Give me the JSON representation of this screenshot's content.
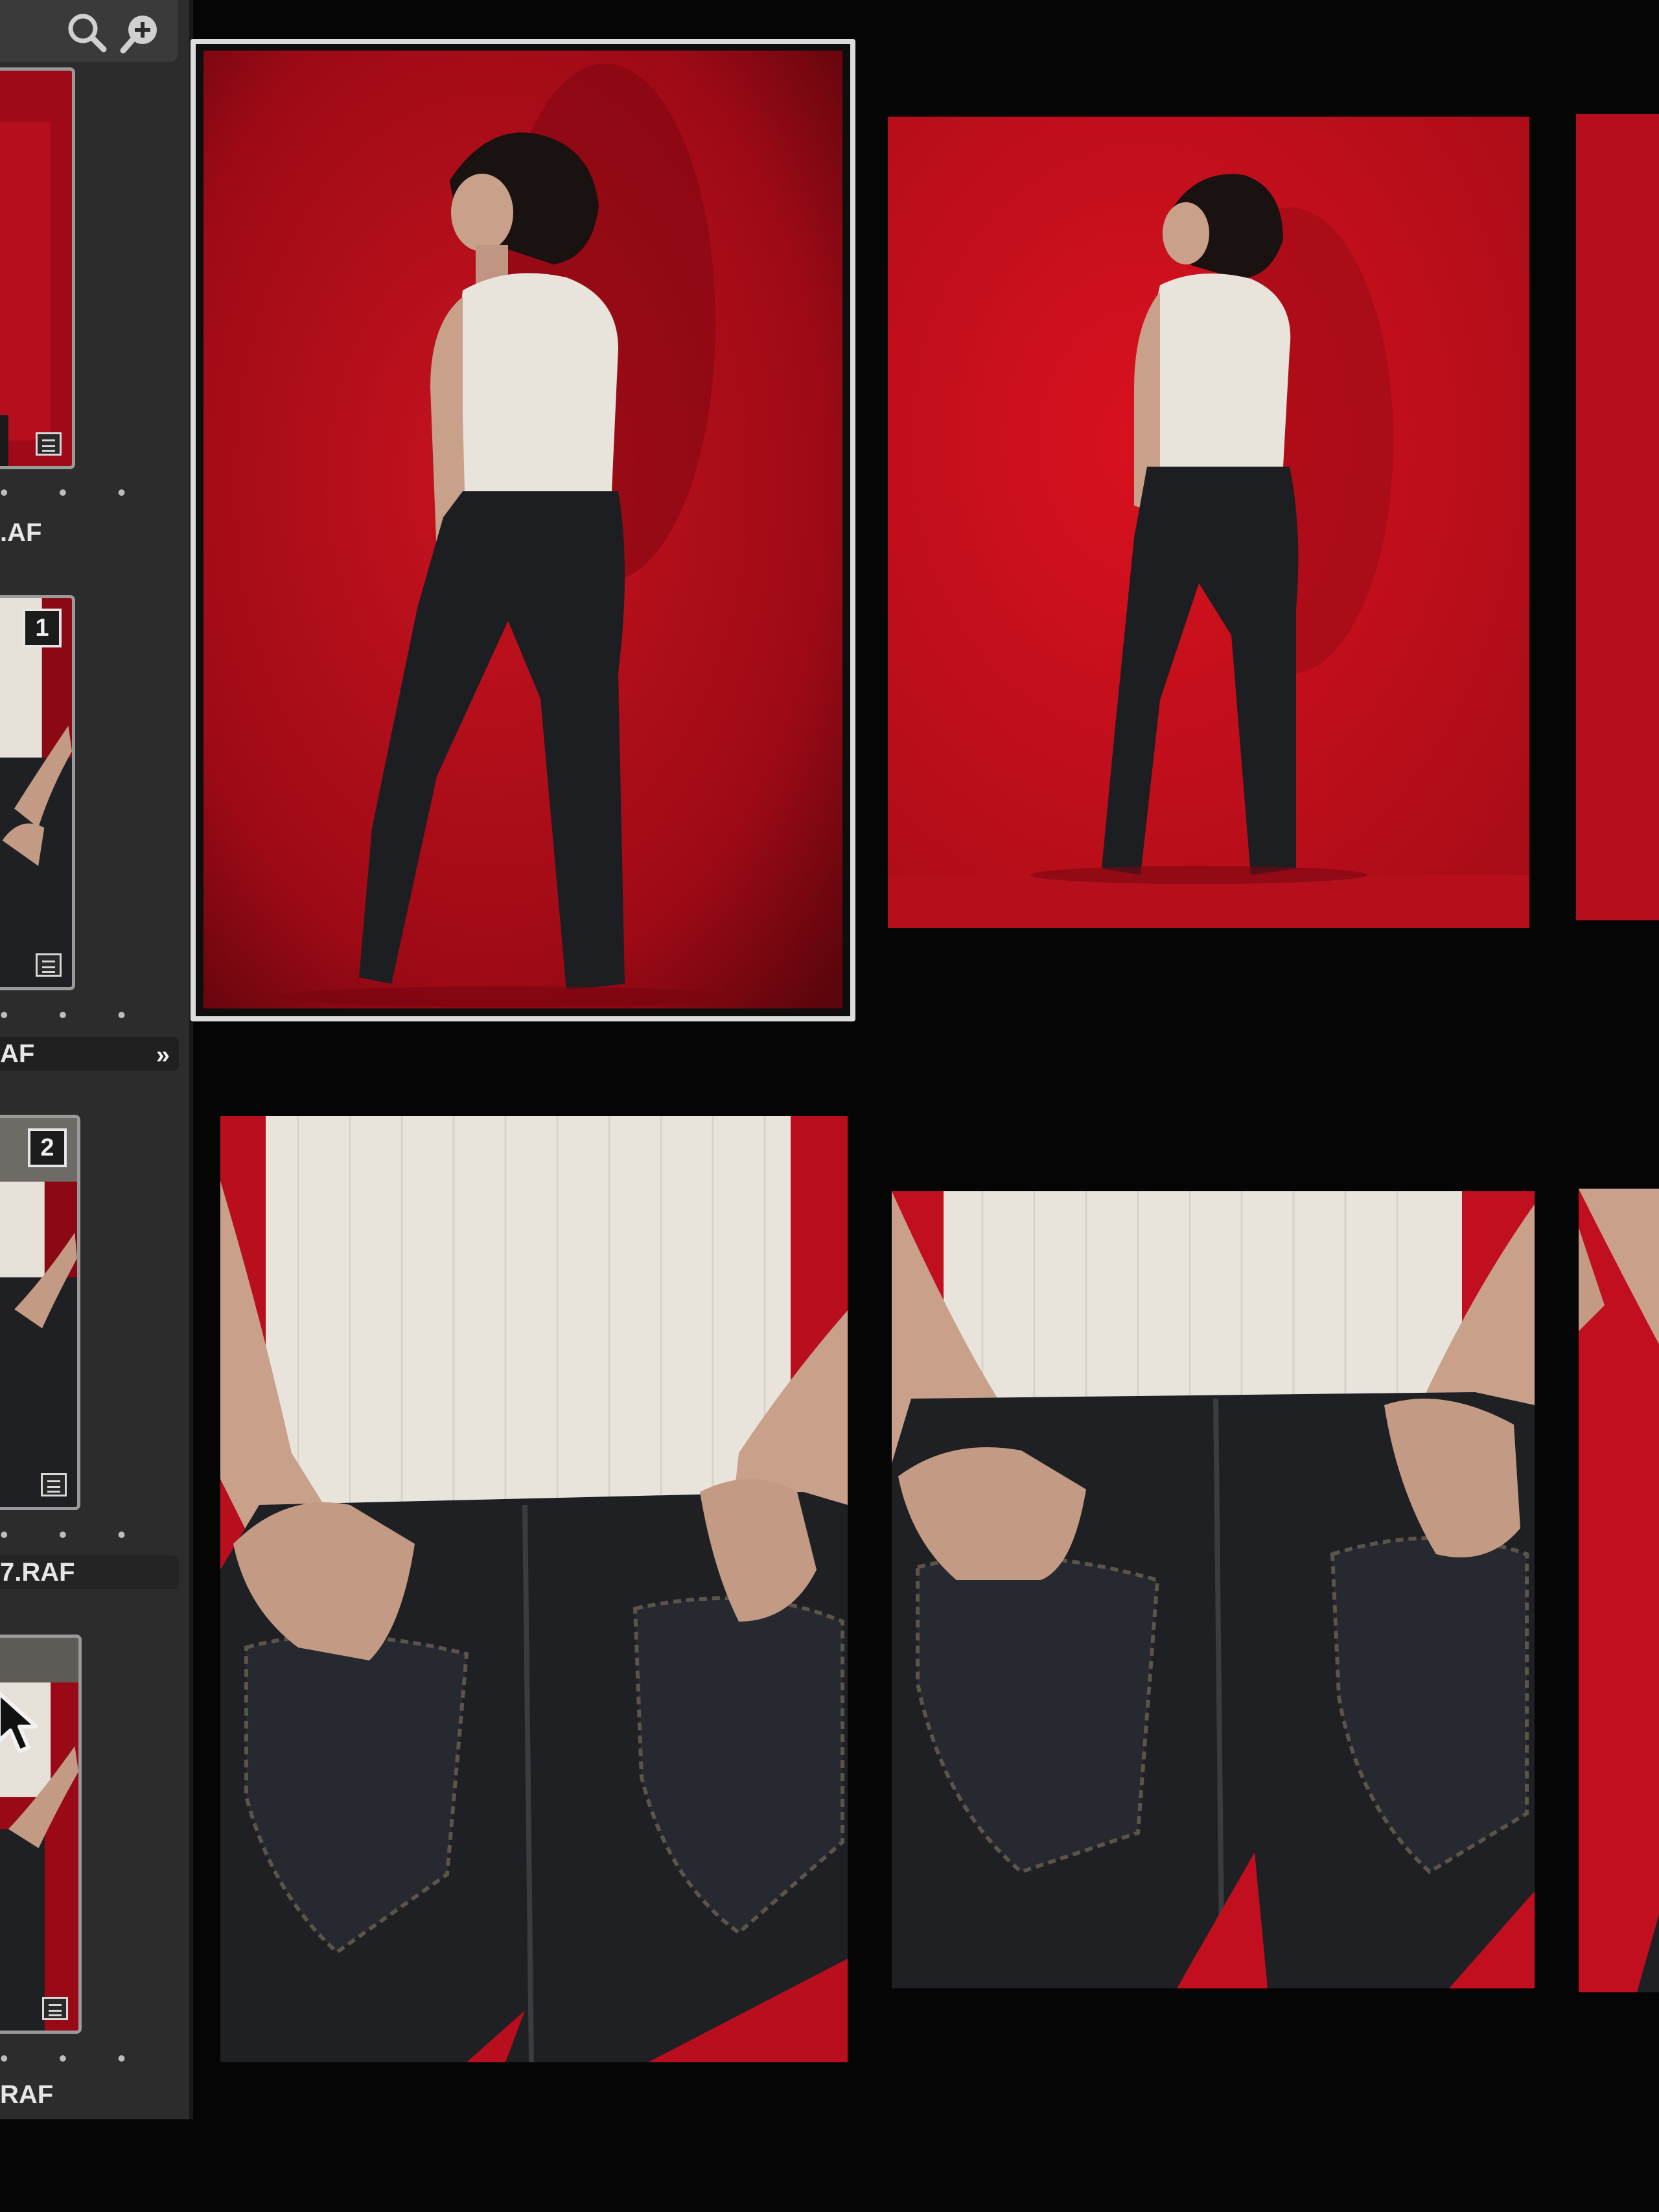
{
  "sidebar": {
    "toolbar": {
      "icons": [
        "search-icon",
        "zoom-in-icon"
      ]
    },
    "thumbnails": [
      {
        "badge": "",
        "filename": ".AF",
        "selected": false
      },
      {
        "badge": "1",
        "filename": "AF",
        "selected": true
      },
      {
        "badge": "2",
        "filename": "7.RAF",
        "selected": false
      },
      {
        "badge": "",
        "filename": "RAF",
        "selected": false
      }
    ],
    "dots": "• • •",
    "expand_icon": "»"
  },
  "grid": {
    "photos": [
      {
        "name": "full-body-back-pose-1",
        "selected": true
      },
      {
        "name": "full-body-back-pose-2",
        "selected": false
      },
      {
        "name": "full-body-partial-3",
        "selected": false
      },
      {
        "name": "closeup-jeans-pockets-1",
        "selected": false
      },
      {
        "name": "closeup-jeans-pockets-2",
        "selected": false
      },
      {
        "name": "closeup-partial-3",
        "selected": false
      }
    ]
  },
  "colors": {
    "backdrop_red": "#c10f1f",
    "sweater": "#e8e4dc",
    "jeans": "#1c1e22",
    "hair": "#1a1210",
    "skin": "#c9a18a",
    "panel": "#2c2c2c",
    "selection": "#dcdcdc"
  }
}
